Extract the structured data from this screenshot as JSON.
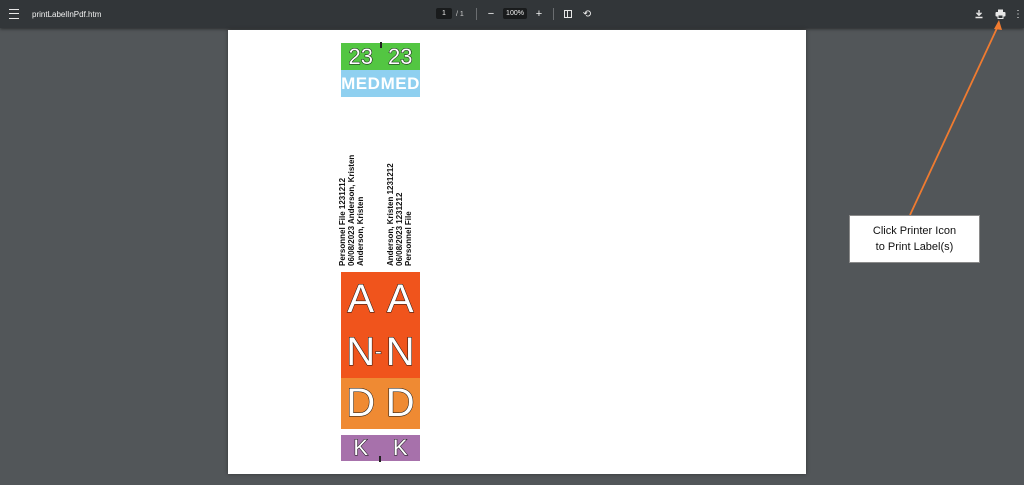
{
  "toolbar": {
    "title": "printLabelInPdf.htm",
    "page_current": "1",
    "page_separator": "/",
    "page_total": "1",
    "zoom_out": "−",
    "zoom_level": "100%",
    "zoom_in": "+",
    "rotate_glyph": "⟲",
    "more_glyph": "⋮"
  },
  "labels": {
    "year_left": "23",
    "year_right": "23",
    "dept_left": "MED",
    "dept_right": "MED",
    "info_left": {
      "line1": "Personnel File    1231212",
      "line2": "06/08/2023  Anderson, Kristen",
      "line3": "Anderson, Kristen"
    },
    "info_right": {
      "line1": "Anderson, Kristen    1231212",
      "line2": "06/08/2023    1231212",
      "line3": "Personnel File"
    },
    "alpha": [
      {
        "left": "A",
        "right": "A"
      },
      {
        "left": "N",
        "right": "N"
      },
      {
        "left": "D",
        "right": "D"
      },
      {
        "left": "K",
        "right": "K"
      }
    ],
    "alpha_divider": "-"
  },
  "callout": {
    "line1": "Click Printer Icon",
    "line2": "to Print Label(s)",
    "arrow_color": "#f07b30"
  },
  "colors": {
    "toolbar_bg": "#323639",
    "viewer_bg": "#525659",
    "year_green": "#53c642",
    "med_blue": "#8fd0f0",
    "alpha_orange": "#f0541c",
    "alpha_light_orange": "#ef8a33",
    "alpha_purple": "#a771ab"
  }
}
